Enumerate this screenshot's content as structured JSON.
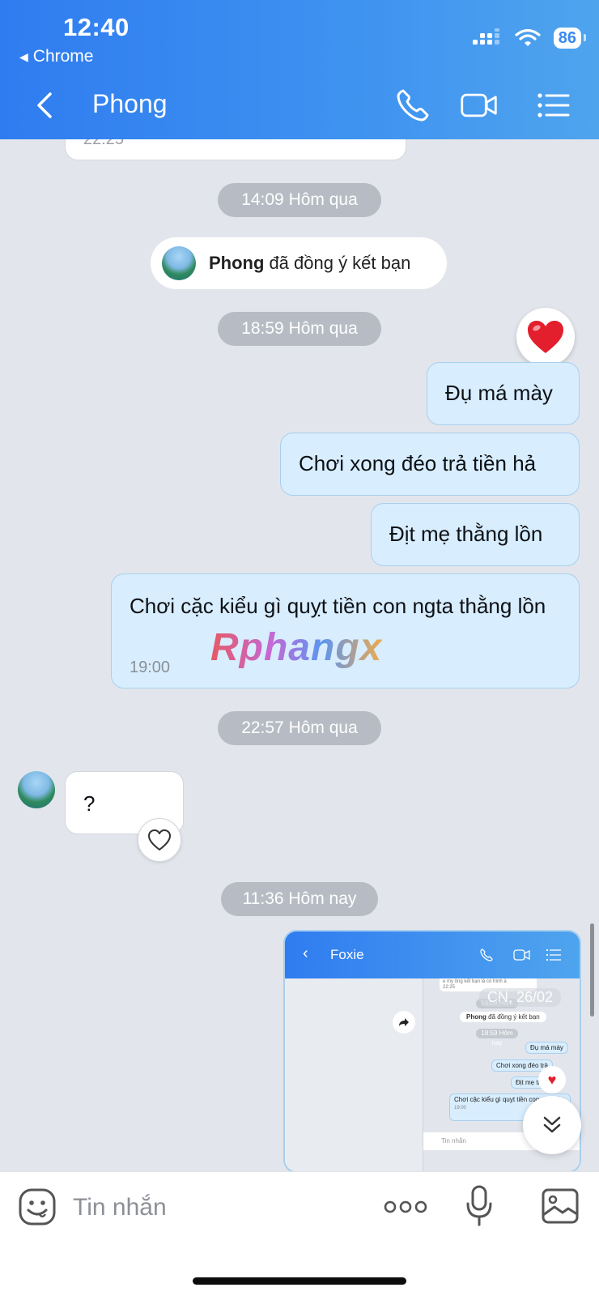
{
  "status_bar": {
    "time": "12:40",
    "back_app": "Chrome",
    "battery": "86"
  },
  "header": {
    "title": "Phong"
  },
  "chat": {
    "top_cut_time": "22:25",
    "separator_1": "14:09 Hôm qua",
    "friend_event": {
      "name": "Phong",
      "text": "đã đồng ý kết bạn"
    },
    "separator_2": "18:59 Hôm qua",
    "reaction": "heart",
    "outgoing": [
      {
        "text": "Đụ má mày"
      },
      {
        "text": "Chơi xong đéo trả tiền hả"
      },
      {
        "text": "Địt mẹ thằng lồn"
      },
      {
        "text": "Chơi cặc kiểu gì quỵt tiền con ngta thằng lồn",
        "time": "19:00"
      }
    ],
    "watermark": "Rphangx",
    "separator_3": "22:57 Hôm qua",
    "incoming": {
      "text": "?"
    },
    "separator_4": "11:36 Hôm nay",
    "thumbnail": {
      "title": "Foxie",
      "date_overlay": "CN, 26/02",
      "friend_event_name": "Phong",
      "friend_event_text": "đã đồng ý kết bạn",
      "pill_1": "14:09 Hôm nay",
      "pill_2": "18:59 Hôm nay",
      "top_text": "e my ông kết bạn là có hình à",
      "top_time": "22:25",
      "messages": [
        "Đụ má mày",
        "Chơi xong đéo trả",
        "Địt mẹ th",
        "Chơi cặc kiểu gì quỵt tiền con ngta lồn"
      ],
      "last_time": "19:00",
      "input_placeholder": "Tin nhắn"
    }
  },
  "composer": {
    "placeholder": "Tin nhắn"
  },
  "colors": {
    "header": "#3a88ef",
    "outgoing_bubble": "#d8edfd",
    "background": "#e2e6ec"
  }
}
